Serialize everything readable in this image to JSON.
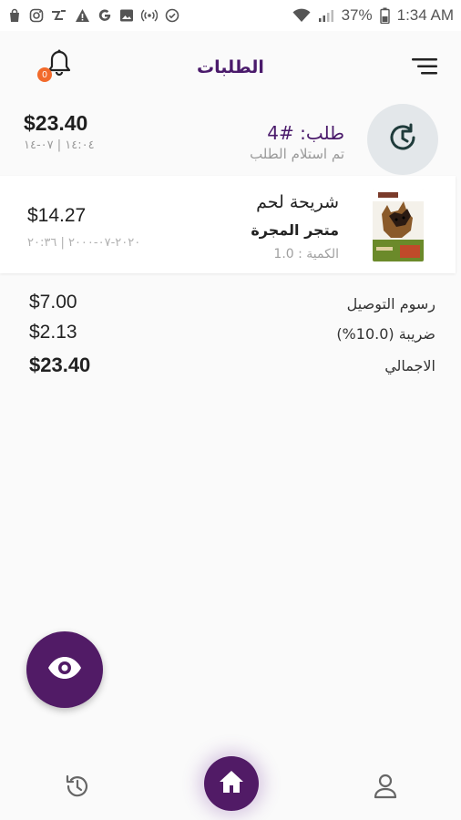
{
  "status_bar": {
    "battery_percent": "37%",
    "time": "1:34 AM",
    "left_icons": [
      "bag-icon",
      "instagram-icon",
      "news-icon",
      "warning-icon",
      "google-icon",
      "image-icon",
      "radio-icon",
      "check-circle-icon"
    ],
    "right_icons": [
      "wifi-icon",
      "signal-icon",
      "battery-icon"
    ]
  },
  "app_bar": {
    "title": "الطلبات",
    "notification_count": "0"
  },
  "order": {
    "number": "طلب: #4",
    "status": "تم استلام الطلب",
    "total": "$23.40",
    "date": "١٤:٠٤ | ٠٧-١٤"
  },
  "item": {
    "name": "شريحة لحم",
    "store": "متجر المجرة",
    "quantity": "الكمية : 1.0",
    "price": "$14.27",
    "date": "٢٠٢٠-٠٧-٢٠٠٠ | ٢٠:٣٦"
  },
  "summary": {
    "delivery_label": "رسوم التوصيل",
    "delivery_value": "$7.00",
    "tax_label": "ضريبة (10.0%)",
    "tax_value": "$2.13",
    "total_label": "الاجمالي",
    "total_value": "$23.40"
  },
  "colors": {
    "primary": "#511b66",
    "badge": "#f26a2b",
    "history_bg": "#e3e7ea"
  }
}
